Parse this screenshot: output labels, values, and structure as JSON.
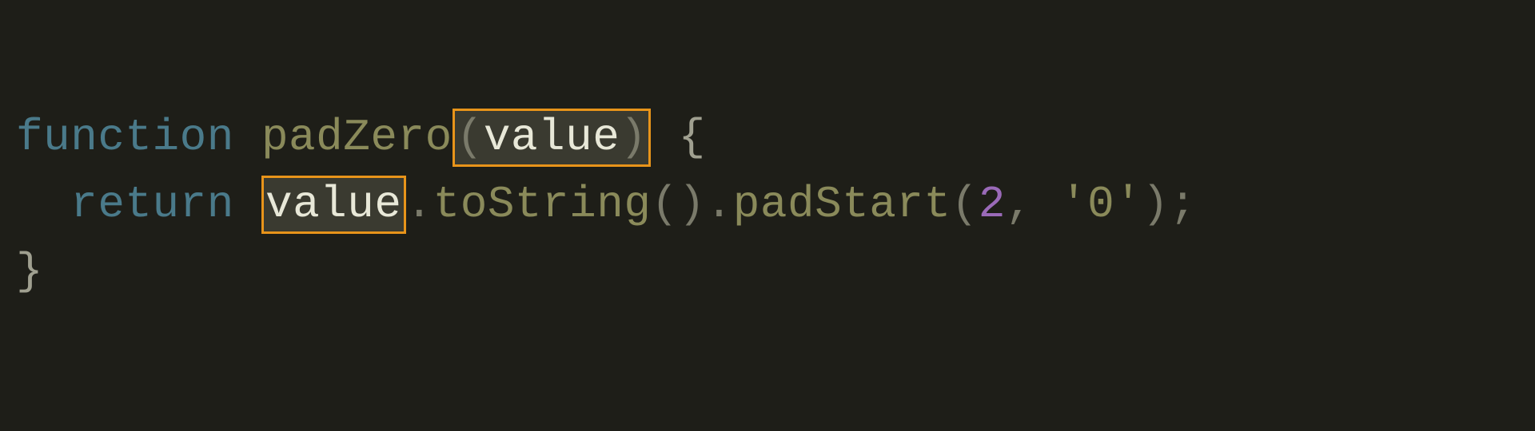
{
  "code": {
    "line1": {
      "keyword_function": "function",
      "space1": " ",
      "func_name": "padZero",
      "param_open": "(",
      "param_name": "value",
      "param_close": ")",
      "space2": " ",
      "brace_open": "{"
    },
    "line2": {
      "indent": "  ",
      "keyword_return": "return",
      "space1": " ",
      "identifier": "value",
      "dot1": ".",
      "method1": "toString",
      "parens1": "()",
      "dot2": ".",
      "method2": "padStart",
      "paren_open": "(",
      "arg_num": "2",
      "comma": ",",
      "space2": " ",
      "arg_str": "'0'",
      "paren_close": ")",
      "semicolon": ";"
    },
    "line3": {
      "brace_close": "}"
    }
  },
  "highlight_color": "#e8941a"
}
